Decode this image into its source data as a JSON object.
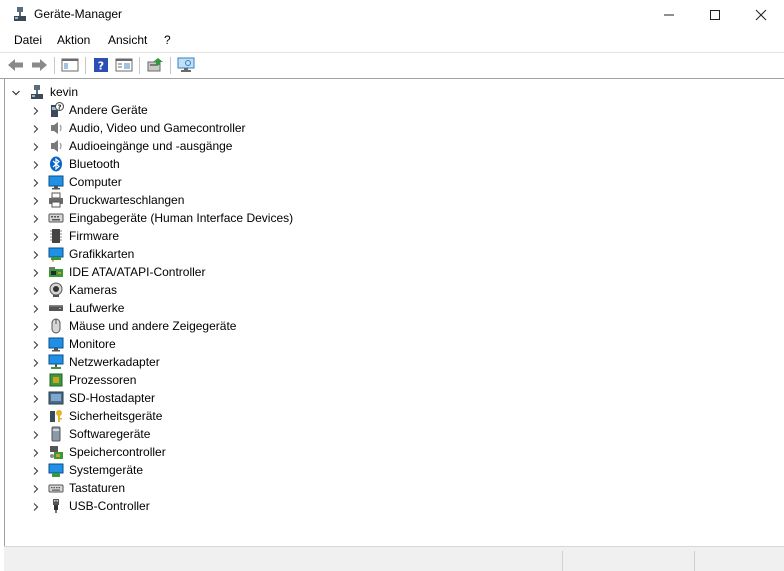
{
  "window": {
    "title": "Geräte-Manager",
    "icon": "device-manager-icon",
    "controls": [
      "minimize-icon",
      "maximize-icon",
      "close-icon"
    ]
  },
  "menubar": {
    "items": [
      "Datei",
      "Aktion",
      "Ansicht",
      "?"
    ]
  },
  "toolbar": {
    "buttons": [
      "back-arrow-icon",
      "forward-arrow-icon",
      "show-hide-console-tree-icon",
      "help-icon",
      "properties-icon",
      "update-driver-icon",
      "scan-hardware-icon"
    ]
  },
  "tree": {
    "root": {
      "label": "kevin",
      "icon": "computer-network-icon",
      "expanded": true
    },
    "categories": [
      {
        "label": "Andere Geräte",
        "icon": "unknown-device-icon"
      },
      {
        "label": "Audio, Video und Gamecontroller",
        "icon": "speaker-icon"
      },
      {
        "label": "Audioeingänge und -ausgänge",
        "icon": "speaker-icon"
      },
      {
        "label": "Bluetooth",
        "icon": "bluetooth-icon"
      },
      {
        "label": "Computer",
        "icon": "monitor-icon"
      },
      {
        "label": "Druckwarteschlangen",
        "icon": "printer-icon"
      },
      {
        "label": "Eingabegeräte (Human Interface Devices)",
        "icon": "hid-icon"
      },
      {
        "label": "Firmware",
        "icon": "firmware-icon"
      },
      {
        "label": "Grafikkarten",
        "icon": "display-adapter-icon"
      },
      {
        "label": "IDE ATA/ATAPI-Controller",
        "icon": "ide-controller-icon"
      },
      {
        "label": "Kameras",
        "icon": "camera-icon"
      },
      {
        "label": "Laufwerke",
        "icon": "disk-drive-icon"
      },
      {
        "label": "Mäuse und andere Zeigegeräte",
        "icon": "mouse-icon"
      },
      {
        "label": "Monitore",
        "icon": "monitor-icon"
      },
      {
        "label": "Netzwerkadapter",
        "icon": "network-adapter-icon"
      },
      {
        "label": "Prozessoren",
        "icon": "processor-icon"
      },
      {
        "label": "SD-Hostadapter",
        "icon": "sd-host-icon"
      },
      {
        "label": "Sicherheitsgeräte",
        "icon": "security-key-icon"
      },
      {
        "label": "Softwaregeräte",
        "icon": "software-device-icon"
      },
      {
        "label": "Speichercontroller",
        "icon": "storage-controller-icon"
      },
      {
        "label": "Systemgeräte",
        "icon": "system-device-icon"
      },
      {
        "label": "Tastaturen",
        "icon": "keyboard-icon"
      },
      {
        "label": "USB-Controller",
        "icon": "usb-icon"
      }
    ]
  },
  "colors": {
    "accent": "#0078d4",
    "window_bg": "#ffffff",
    "statusbar_bg": "#f0f0f0"
  }
}
